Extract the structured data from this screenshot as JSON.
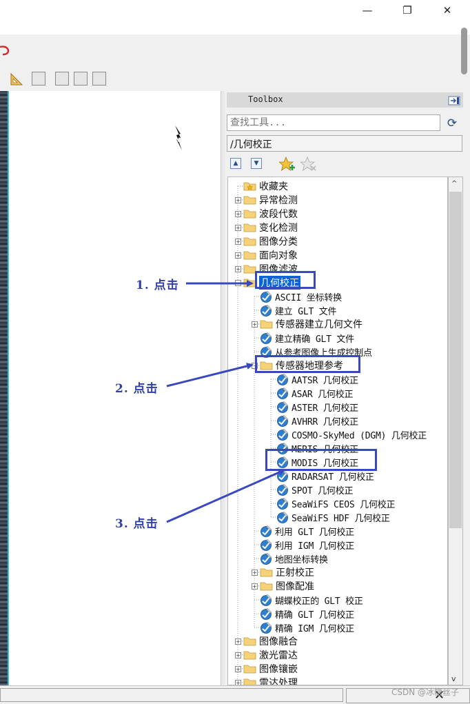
{
  "window": {
    "minimize_glyph": "—",
    "maximize_glyph": "❐",
    "close_glyph": "✕"
  },
  "toolbox": {
    "title": "Toolbox",
    "search_placeholder": "查找工具...",
    "path": "/几何校正",
    "tree": [
      {
        "label": "收藏夹",
        "kind": "folder",
        "icon": "star-folder-icon",
        "level": 0,
        "expander": ""
      },
      {
        "label": "异常检测",
        "kind": "folder",
        "level": 0,
        "expander": "+"
      },
      {
        "label": "波段代数",
        "kind": "folder",
        "level": 0,
        "expander": "+"
      },
      {
        "label": "变化检测",
        "kind": "folder",
        "level": 0,
        "expander": "+"
      },
      {
        "label": "图像分类",
        "kind": "folder",
        "level": 0,
        "expander": "+"
      },
      {
        "label": "面向对象",
        "kind": "folder",
        "level": 0,
        "expander": "+"
      },
      {
        "label": "图像滤波",
        "kind": "folder",
        "level": 0,
        "expander": "+"
      },
      {
        "label": "几何校正",
        "kind": "folder",
        "level": 0,
        "expander": "-",
        "selected": true
      },
      {
        "label": "ASCII 坐标转换",
        "kind": "tool",
        "level": 1
      },
      {
        "label": "建立 GLT 文件",
        "kind": "tool",
        "level": 1
      },
      {
        "label": "传感器建立几何文件",
        "kind": "folder",
        "level": 1,
        "expander": "+"
      },
      {
        "label": "建立精确 GLT 文件",
        "kind": "tool",
        "level": 1
      },
      {
        "label": "从参考图像上生成控制点",
        "kind": "tool",
        "level": 1
      },
      {
        "label": "传感器地理参考",
        "kind": "folder",
        "level": 1,
        "expander": "-"
      },
      {
        "label": "AATSR 几何校正",
        "kind": "tool",
        "level": 2
      },
      {
        "label": "ASAR 几何校正",
        "kind": "tool",
        "level": 2
      },
      {
        "label": "ASTER 几何校正",
        "kind": "tool",
        "level": 2
      },
      {
        "label": "AVHRR 几何校正",
        "kind": "tool",
        "level": 2
      },
      {
        "label": "COSMO-SkyMed (DGM) 几何校正",
        "kind": "tool",
        "level": 2
      },
      {
        "label": "MERIS 几何校正",
        "kind": "tool",
        "level": 2
      },
      {
        "label": "MODIS 几何校正",
        "kind": "tool",
        "level": 2
      },
      {
        "label": "RADARSAT 几何校正",
        "kind": "tool",
        "level": 2
      },
      {
        "label": "SPOT 几何校正",
        "kind": "tool",
        "level": 2
      },
      {
        "label": "SeaWiFS CEOS 几何校正",
        "kind": "tool",
        "level": 2
      },
      {
        "label": "SeaWiFS HDF 几何校正",
        "kind": "tool",
        "level": 2
      },
      {
        "label": "利用 GLT 几何校正",
        "kind": "tool",
        "level": 1
      },
      {
        "label": "利用 IGM 几何校正",
        "kind": "tool",
        "level": 1
      },
      {
        "label": "地图坐标转换",
        "kind": "tool",
        "level": 1
      },
      {
        "label": "正射校正",
        "kind": "folder",
        "level": 1,
        "expander": "+"
      },
      {
        "label": "图像配准",
        "kind": "folder",
        "level": 1,
        "expander": "+"
      },
      {
        "label": "蝴蝶校正的 GLT 校正",
        "kind": "tool",
        "level": 1
      },
      {
        "label": "精确 GLT 几何校正",
        "kind": "tool",
        "level": 1
      },
      {
        "label": "精确 IGM 几何校正",
        "kind": "tool",
        "level": 1
      },
      {
        "label": "图像融合",
        "kind": "folder",
        "level": 0,
        "expander": "+"
      },
      {
        "label": "激光雷达",
        "kind": "folder",
        "level": 0,
        "expander": "+"
      },
      {
        "label": "图像镶嵌",
        "kind": "folder",
        "level": 0,
        "expander": "+"
      },
      {
        "label": "雷达处理",
        "kind": "folder",
        "level": 0,
        "expander": "+"
      }
    ]
  },
  "annotations": {
    "step1": "1. 点击",
    "step2": "2. 点击",
    "step3": "3. 点击"
  },
  "watermark": "CSDN @冰糖丝子",
  "colors": {
    "annotation": "#3a48c0",
    "selection": "#0a64d6",
    "folder": "#f5d27a"
  }
}
